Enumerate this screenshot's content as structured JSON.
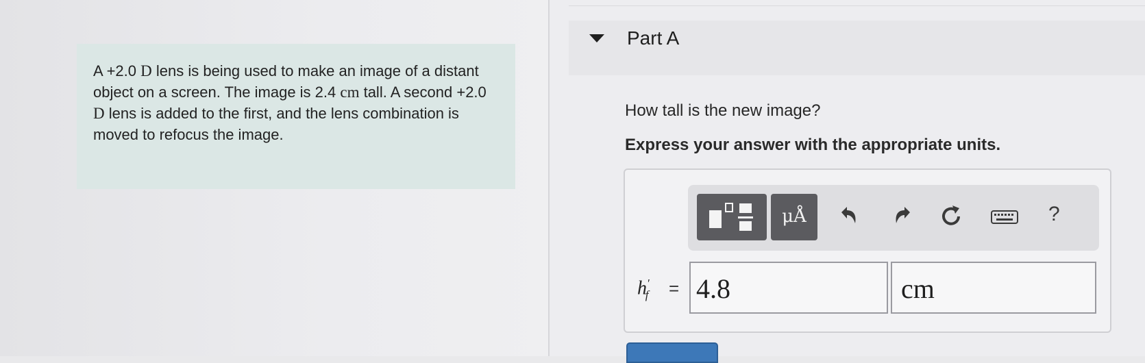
{
  "problem": {
    "text_parts": [
      "A +2.0 ",
      "D",
      " lens is being used to make an image of a distant object on a screen. The image is 2.4 ",
      "cm",
      " tall. A second +2.0 ",
      "D",
      " lens is added to the first, and the lens combination is moved to refocus the image."
    ]
  },
  "part": {
    "title": "Part A",
    "question": "How tall is the new image?",
    "instruction": "Express your answer with the appropriate units."
  },
  "toolbar": {
    "units_label": "μÅ",
    "help_label": "?",
    "icons": [
      "templates-icon",
      "undo-icon",
      "redo-icon",
      "reset-icon",
      "keyboard-icon"
    ]
  },
  "answer": {
    "variable": "h",
    "variable_sub": "f",
    "variable_prime": "′",
    "equals": "=",
    "value": "4.8",
    "unit": "cm"
  },
  "colors": {
    "problem_bg": "#dbe7e5",
    "toolbar_button": "#5b5b5f",
    "submit": "#3d78b8"
  }
}
